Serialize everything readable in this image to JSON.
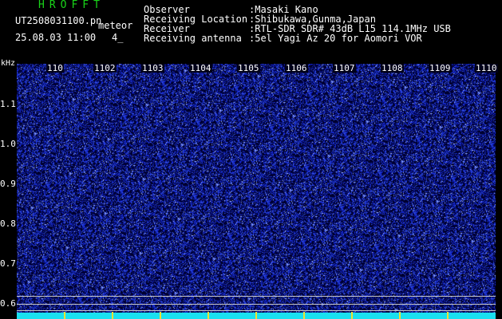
{
  "header": {
    "app_title": "HROFFT",
    "file_name": "UT2508031100.pn",
    "mode_label": "meteor",
    "timestamp": "25.08.03 11:00",
    "channel": "4_"
  },
  "station_info": [
    {
      "label": "Observer",
      "value": ":Masaki Kano"
    },
    {
      "label": "Receiving Location",
      "value": ":Shibukawa,Gunma,Japan"
    },
    {
      "label": "Receiver",
      "value": ":RTL-SDR SDR# 43dB L15 114.1MHz USB"
    },
    {
      "label": "Receiving antenna",
      "value": ":5el Yagi Az 20 for Aomori VOR"
    }
  ],
  "axis": {
    "unit": "kHz",
    "time_labels": [
      "110",
      "1102",
      "1103",
      "1104",
      "1105",
      "1106",
      "1107",
      "1108",
      "1109",
      "1110"
    ],
    "freq_labels": [
      "1.1",
      "1.0",
      "0.9",
      "0.8",
      "0.7",
      "0.6"
    ]
  },
  "colors": {
    "title_green": "#19d419",
    "noise_blue": "#2a4cff",
    "baseline_cyan": "#19e0f0",
    "tick_yellow": "#f0e030"
  }
}
